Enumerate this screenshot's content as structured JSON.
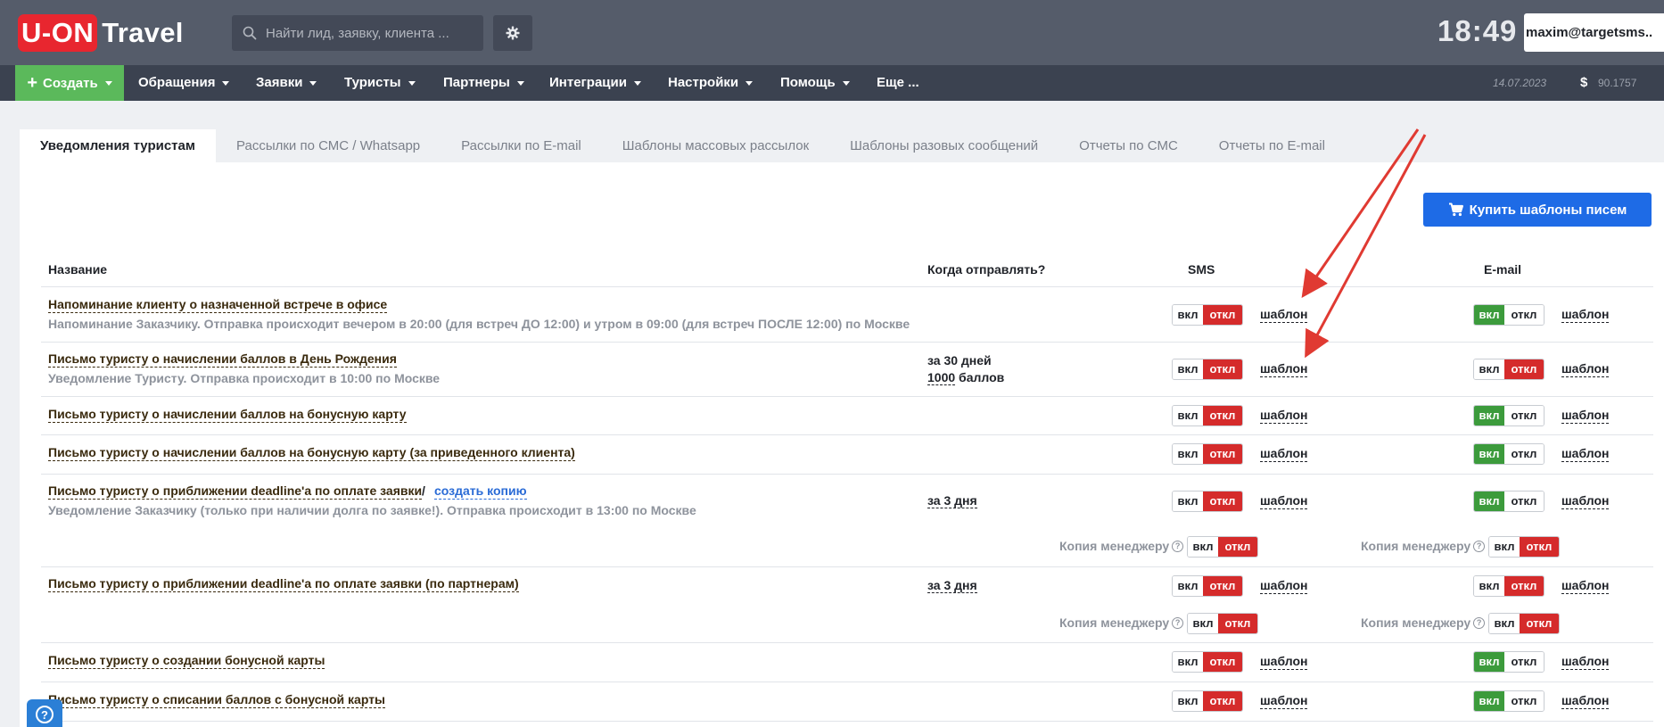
{
  "header": {
    "logo_box": "U-ON",
    "logo_text": "Travel",
    "search_placeholder": "Найти лид, заявку, клиента ...",
    "clock": "18:49",
    "user": "maxim@targetsms.."
  },
  "nav": {
    "create": "Создать",
    "items": [
      "Обращения",
      "Заявки",
      "Туристы",
      "Партнеры",
      "Интеграции",
      "Настройки",
      "Помощь",
      "Еще ..."
    ],
    "date": "14.07.2023",
    "currency_symbol": "$",
    "balance": "90.1757"
  },
  "tabs": [
    "Уведомления туристам",
    "Рассылки по СМС / Whatsapp",
    "Рассылки по E-mail",
    "Шаблоны массовых рассылок",
    "Шаблоны разовых сообщений",
    "Отчеты по СМС",
    "Отчеты по E-mail"
  ],
  "buy_button": "Купить шаблоны писем",
  "columns": {
    "name": "Название",
    "when": "Когда отправлять?",
    "sms": "SMS",
    "email": "E-mail"
  },
  "toggle_labels": {
    "on": "вкл",
    "off": "откл"
  },
  "template_label": "шаблон",
  "copy_manager_label": "Копия менеджеру",
  "create_copy_label": "создать копию",
  "rows": [
    {
      "title": "Напоминание клиенту о назначенной встрече в офисе",
      "subtitle": "Напоминание Заказчику. Отправка происходит вечером в 20:00 (для встреч ДО 12:00) и утром в 09:00 (для встреч ПОСЛЕ 12:00) по Москве",
      "sms": "off",
      "email": "on"
    },
    {
      "title": "Письмо туристу о начислении баллов в День Рождения",
      "subtitle": "Уведомление Туристу. Отправка происходит в 10:00 по Москве",
      "when_1": "за 30 дней",
      "when_2_value": "1000",
      "when_2_unit": " баллов",
      "sms": "off",
      "email": "off"
    },
    {
      "title": "Письмо туристу о начислении баллов на бонусную карту",
      "sms": "off",
      "email": "on"
    },
    {
      "title": "Письмо туристу о начислении баллов на бонусную карту (за приведенного клиента)",
      "sms": "off",
      "email": "on"
    },
    {
      "title": "Письмо туристу о приближении deadline'a по оплате заявки",
      "subtitle": "Уведомление Заказчику (только при наличии долга по заявке!). Отправка происходит в 13:00 по Москве",
      "when_1": "за 3 дня",
      "sms": "off",
      "email": "on",
      "copy_sms": "off",
      "copy_email": "off"
    },
    {
      "title": "Письмо туристу о приближении deadline'a по оплате заявки (по партнерам)",
      "when_1": "за 3 дня",
      "sms": "off",
      "email": "off",
      "copy_sms": "off",
      "copy_email": "off"
    },
    {
      "title": "Письмо туристу о создании бонусной карты",
      "sms": "off",
      "email": "on"
    },
    {
      "title": "Письмо туристу о списании баллов с бонусной карты",
      "sms": "off",
      "email": "on"
    }
  ],
  "slash": "/",
  "colors": {
    "accent_blue": "#1e6be6",
    "on_green": "#3c9b3c",
    "off_red": "#d52b2b",
    "create_green": "#5bb95b",
    "arrow_red": "#e03a32"
  }
}
